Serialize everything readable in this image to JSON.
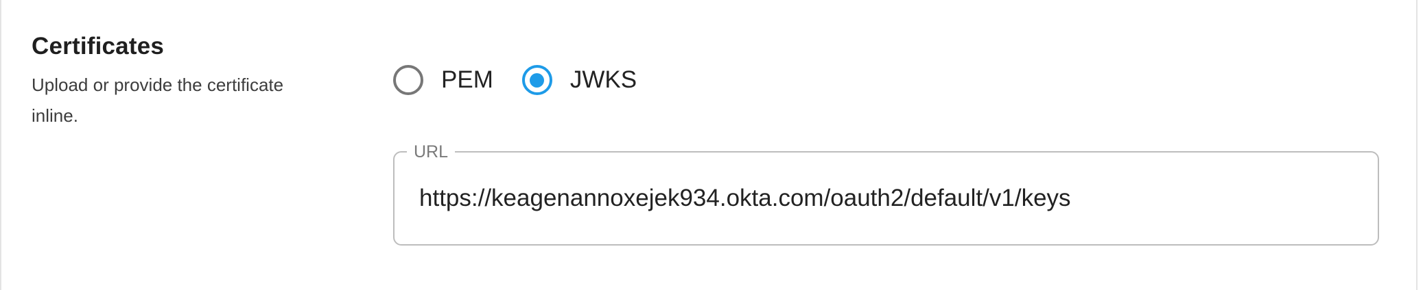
{
  "certificates": {
    "title": "Certificates",
    "description": "Upload or provide the certificate inline."
  },
  "format": {
    "options": [
      {
        "label": "PEM",
        "selected": false
      },
      {
        "label": "JWKS",
        "selected": true
      }
    ]
  },
  "url_field": {
    "label": "URL",
    "value": "https://keagenannoxejek934.okta.com/oauth2/default/v1/keys"
  },
  "colors": {
    "accent": "#1e9be8",
    "radio_unselected": "#777777",
    "field_border": "#bdbdbd"
  }
}
